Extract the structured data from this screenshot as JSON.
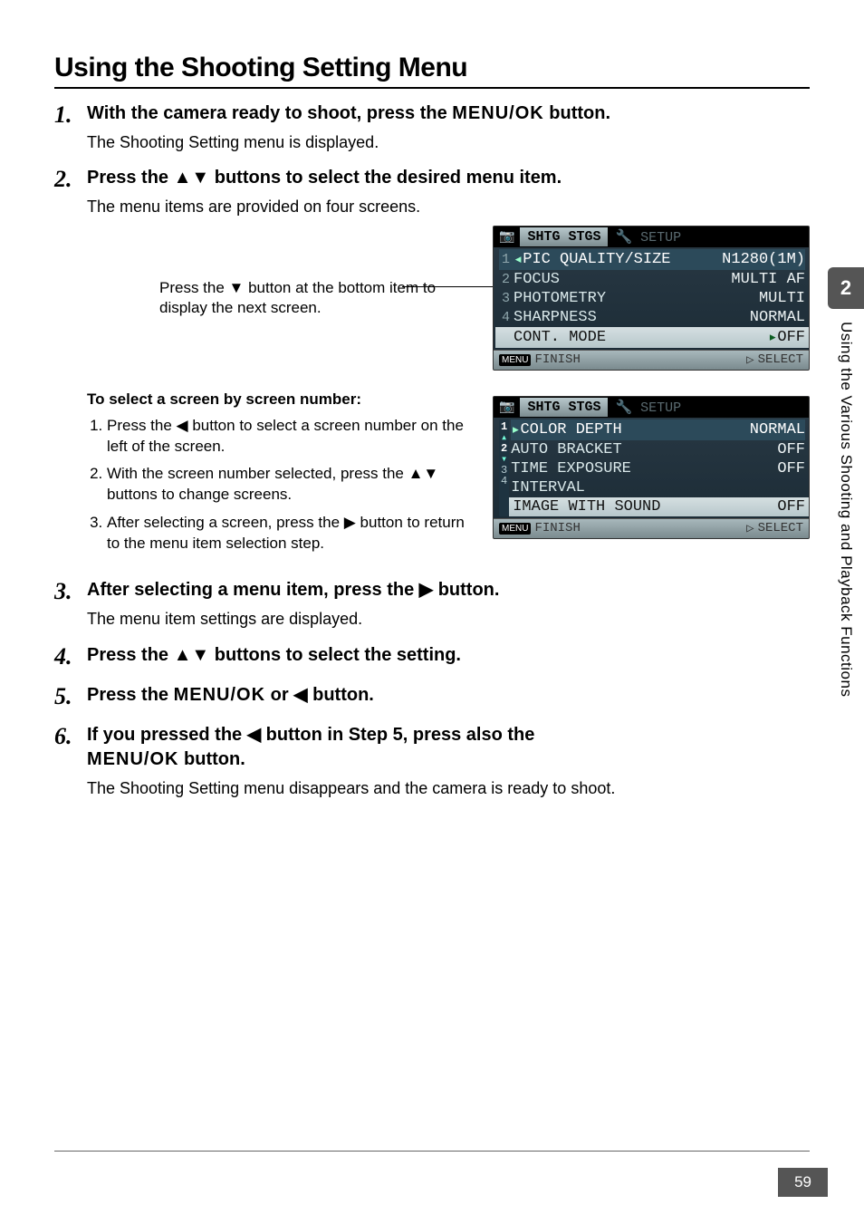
{
  "chapter_number": "2",
  "side_text": "Using the Various Shooting and Playback Functions",
  "page_number": "59",
  "title": "Using the Shooting Setting Menu",
  "steps": {
    "s1": {
      "num": "1.",
      "title_a": "With the camera ready to shoot, press the ",
      "title_b": " button.",
      "desc": "The Shooting Setting menu is displayed.",
      "menuok": "MENU/OK"
    },
    "s2": {
      "num": "2.",
      "title": "Press the ▲▼ buttons to select the desired menu item.",
      "desc": "The menu items are provided on four screens."
    },
    "s3": {
      "num": "3.",
      "title": "After selecting a menu item, press the ▶ button.",
      "desc": "The menu item settings are displayed."
    },
    "s4": {
      "num": "4.",
      "title": "Press the ▲▼ buttons to select the setting."
    },
    "s5": {
      "num": "5.",
      "title_a": "Press the ",
      "title_b": " or ◀ button.",
      "menuok": "MENU/OK"
    },
    "s6": {
      "num": "6.",
      "title_a": "If you pressed the ◀ button in Step 5, press also the ",
      "title_b": " button.",
      "menuok": "MENU/OK",
      "desc": "The Shooting Setting menu disappears and the camera is ready to shoot."
    }
  },
  "caption_bottom": "Press the ▼ button at the bottom item to display the next screen.",
  "sub": {
    "title": "To select a screen by screen number:",
    "i1": "Press the ◀ button to select a screen number on the left of the screen.",
    "i2": "With the screen number selected, press the ▲▼ buttons to change screens.",
    "i3": "After selecting a screen, press the ▶ button to return to the menu item selection step."
  },
  "lcd1": {
    "tab_active": "SHTG STGS",
    "tab_inactive": "SETUP",
    "r1": {
      "idx": "1",
      "lbl": "PIC QUALITY/SIZE",
      "val": "N1280(1M)"
    },
    "r2": {
      "idx": "2",
      "lbl": "FOCUS",
      "val": "MULTI AF"
    },
    "r3": {
      "idx": "3",
      "lbl": "PHOTOMETRY",
      "val": "MULTI"
    },
    "r4": {
      "idx": "4",
      "lbl": "SHARPNESS",
      "val": "NORMAL"
    },
    "r5": {
      "idx": "",
      "lbl": "CONT. MODE",
      "val": "OFF"
    },
    "f_left": "FINISH",
    "f_right": "SELECT"
  },
  "lcd2": {
    "tab_active": "SHTG STGS",
    "tab_inactive": "SETUP",
    "r1": {
      "lbl": "COLOR DEPTH",
      "val": "NORMAL"
    },
    "r2": {
      "lbl": "AUTO BRACKET",
      "val": "OFF"
    },
    "r3": {
      "lbl": "TIME EXPOSURE",
      "val": "OFF"
    },
    "r4": {
      "lbl": "INTERVAL",
      "val": ""
    },
    "r5": {
      "lbl": "IMAGE WITH SOUND",
      "val": "OFF"
    },
    "pager": {
      "p1": "1",
      "p2": "2",
      "p3": "3",
      "p4": "4"
    },
    "f_left": "FINISH",
    "f_right": "SELECT"
  }
}
